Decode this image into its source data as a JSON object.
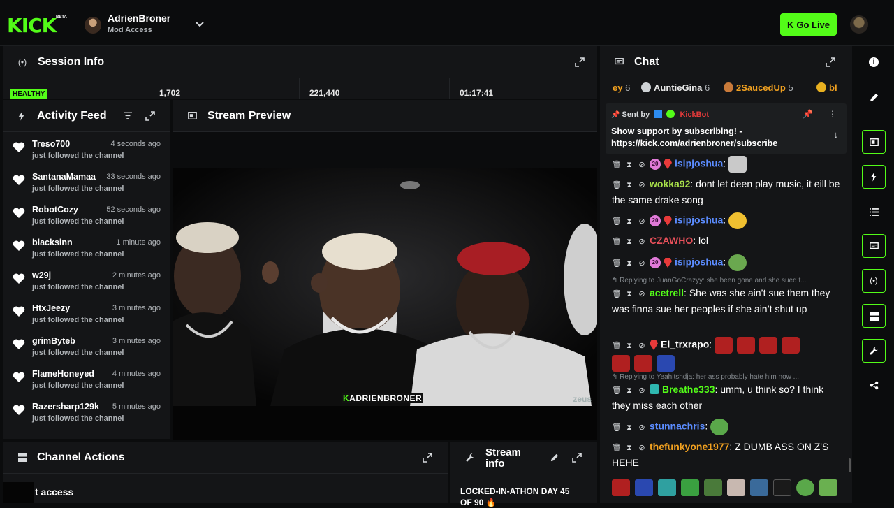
{
  "topbar": {
    "logo": "KICK",
    "beta": "BETA",
    "account_name": "AdrienBroner",
    "account_role": "Mod Access",
    "go_live": "Go Live",
    "go_live_k": "K"
  },
  "session": {
    "title": "Session Info",
    "status": "HEALTHY",
    "viewers": "1,702",
    "followers": "221,440",
    "uptime": "01:17:41"
  },
  "activity": {
    "title": "Activity Feed",
    "items": [
      {
        "name": "Treso700",
        "time": "4 seconds ago",
        "action": "just followed the channel"
      },
      {
        "name": "SantanaMamaa",
        "time": "33 seconds ago",
        "action": "just followed the channel"
      },
      {
        "name": "RobotCozy",
        "time": "52 seconds ago",
        "action": "just followed the channel"
      },
      {
        "name": "blacksinn",
        "time": "1 minute ago",
        "action": "just followed the channel"
      },
      {
        "name": "w29j",
        "time": "2 minutes ago",
        "action": "just followed the channel"
      },
      {
        "name": "HtxJeezy",
        "time": "3 minutes ago",
        "action": "just followed the channel"
      },
      {
        "name": "grimByteb",
        "time": "3 minutes ago",
        "action": "just followed the channel"
      },
      {
        "name": "FlameHoneyed",
        "time": "4 minutes ago",
        "action": "just followed the channel"
      },
      {
        "name": "Razersharp129k",
        "time": "5 minutes ago",
        "action": "just followed the channel"
      }
    ]
  },
  "preview": {
    "title": "Stream Preview",
    "watermark_k": "K",
    "watermark": "ADRIENBRONER",
    "watermark2": "zeus"
  },
  "actions": {
    "title": "Channel Actions",
    "partial_text": "t access"
  },
  "stream_info": {
    "title_line1": "Stream",
    "title_line2": "info",
    "text_line1": "LOCKED-IN-ATHON DAY 45",
    "text_line2": "OF 90 🔥"
  },
  "chat": {
    "title": "Chat",
    "top_strip": [
      {
        "name": "ey",
        "count": "6",
        "color": "#f0a020"
      },
      {
        "name": "AuntieGina",
        "count": "6",
        "color": "#e8e8e8"
      },
      {
        "name": "2SaucedUp",
        "count": "5",
        "color": "#f0a020"
      },
      {
        "name": "bl",
        "count": "",
        "color": "#f0a020"
      }
    ],
    "pinned": {
      "sent_by": "Sent by",
      "bot": "KickBot",
      "message": "Show support by subscribing! -",
      "link": "https://kick.com/adrienbroner/subscribe"
    },
    "messages": [
      {
        "user": "isipjoshua",
        "color": "#5b8cff",
        "text": ""
      },
      {
        "user": "wokka92",
        "color": "#a8e04a",
        "text": "dont let deen play music, it eill be the same drake song"
      },
      {
        "user": "isipjoshua",
        "color": "#5b8cff",
        "text": ""
      },
      {
        "user": "CZAWHO",
        "color": "#e8505a",
        "text": "lol"
      },
      {
        "user": "isipjoshua",
        "color": "#5b8cff",
        "text": ""
      },
      {
        "reply": "Replying to JuanGoCrazyy: she been gone and she sued t...",
        "user": "acetrell",
        "color": "#53fc18",
        "text": "She was she ain’t sue them they was finna sue her peoples if she ain’t shut up"
      },
      {
        "user": "El_trxrapo",
        "color": "#ffffff",
        "text": ""
      },
      {
        "reply": "Replying to Yeahitshdja: her ass probably hate him now ...",
        "user": "Breathe333",
        "color": "#53fc18",
        "text": "umm, u think so? I think they miss each other"
      },
      {
        "user": "stunnachris",
        "color": "#5b8cff",
        "text": ""
      },
      {
        "user": "thefunkyone1977",
        "color": "#f0a020",
        "text": "Z DUMB ASS ON Z'S HEHE"
      }
    ]
  },
  "colors": {
    "accent": "#53fc18",
    "panel": "#141517",
    "bg": "#0b0c0d"
  }
}
